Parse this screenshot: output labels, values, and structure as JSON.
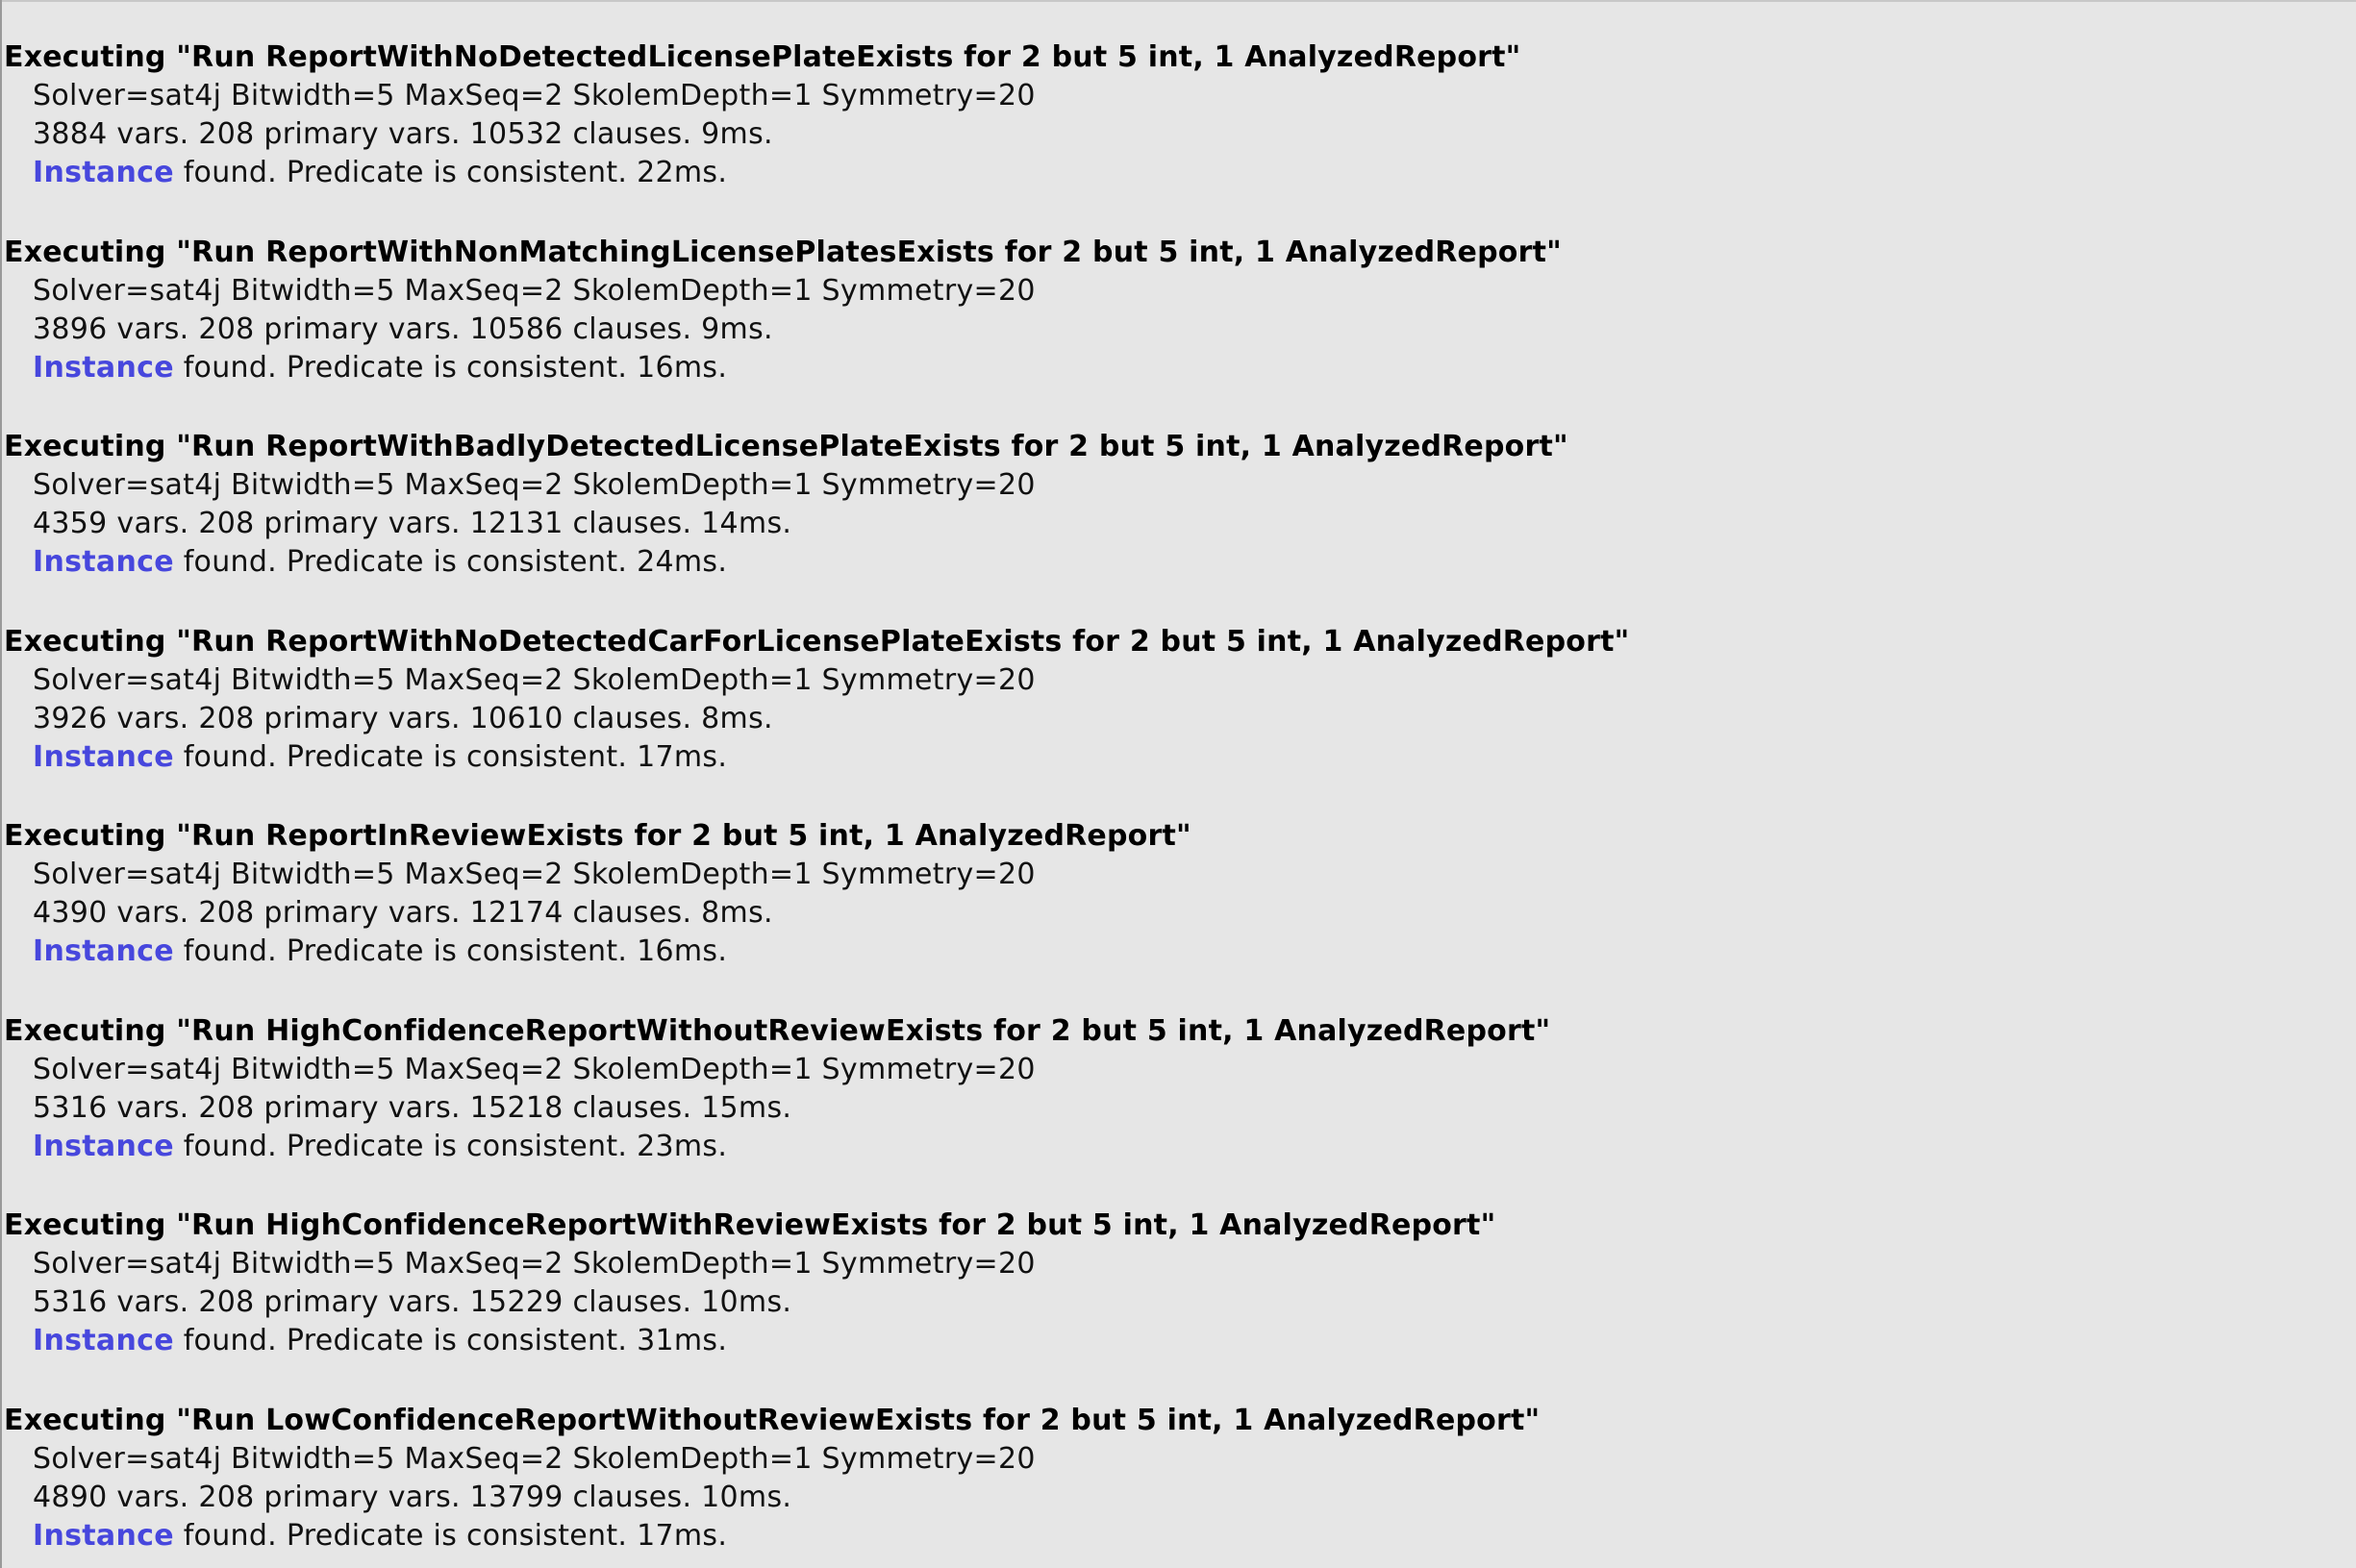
{
  "colors": {
    "background": "#e6e6e6",
    "link": "#4747dd",
    "text": "#000000"
  },
  "log": {
    "entries": [
      {
        "header": "Executing \"Run ReportWithNoDetectedLicensePlateExists for 2 but 5 int, 1 AnalyzedReport\"",
        "solver": "Solver=sat4j Bitwidth=5 MaxSeq=2 SkolemDepth=1 Symmetry=20",
        "stats": "3884 vars. 208 primary vars. 10532 clauses. 9ms.",
        "instance_link": "Instance",
        "result": " found. Predicate is consistent. 22ms."
      },
      {
        "header": "Executing \"Run ReportWithNonMatchingLicensePlatesExists for 2 but 5 int, 1 AnalyzedReport\"",
        "solver": "Solver=sat4j Bitwidth=5 MaxSeq=2 SkolemDepth=1 Symmetry=20",
        "stats": "3896 vars. 208 primary vars. 10586 clauses. 9ms.",
        "instance_link": "Instance",
        "result": " found. Predicate is consistent. 16ms."
      },
      {
        "header": "Executing \"Run ReportWithBadlyDetectedLicensePlateExists for 2 but 5 int, 1 AnalyzedReport\"",
        "solver": "Solver=sat4j Bitwidth=5 MaxSeq=2 SkolemDepth=1 Symmetry=20",
        "stats": "4359 vars. 208 primary vars. 12131 clauses. 14ms.",
        "instance_link": "Instance",
        "result": " found. Predicate is consistent. 24ms."
      },
      {
        "header": "Executing \"Run ReportWithNoDetectedCarForLicensePlateExists for 2 but 5 int, 1 AnalyzedReport\"",
        "solver": "Solver=sat4j Bitwidth=5 MaxSeq=2 SkolemDepth=1 Symmetry=20",
        "stats": "3926 vars. 208 primary vars. 10610 clauses. 8ms.",
        "instance_link": "Instance",
        "result": " found. Predicate is consistent. 17ms."
      },
      {
        "header": "Executing \"Run ReportInReviewExists for 2 but 5 int, 1 AnalyzedReport\"",
        "solver": "Solver=sat4j Bitwidth=5 MaxSeq=2 SkolemDepth=1 Symmetry=20",
        "stats": "4390 vars. 208 primary vars. 12174 clauses. 8ms.",
        "instance_link": "Instance",
        "result": " found. Predicate is consistent. 16ms."
      },
      {
        "header": "Executing \"Run HighConfidenceReportWithoutReviewExists for 2 but 5 int, 1 AnalyzedReport\"",
        "solver": "Solver=sat4j Bitwidth=5 MaxSeq=2 SkolemDepth=1 Symmetry=20",
        "stats": "5316 vars. 208 primary vars. 15218 clauses. 15ms.",
        "instance_link": "Instance",
        "result": " found. Predicate is consistent. 23ms."
      },
      {
        "header": "Executing \"Run HighConfidenceReportWithReviewExists for 2 but 5 int, 1 AnalyzedReport\"",
        "solver": "Solver=sat4j Bitwidth=5 MaxSeq=2 SkolemDepth=1 Symmetry=20",
        "stats": "5316 vars. 208 primary vars. 15229 clauses. 10ms.",
        "instance_link": "Instance",
        "result": " found. Predicate is consistent. 31ms."
      },
      {
        "header": "Executing \"Run LowConfidenceReportWithoutReviewExists for 2 but 5 int, 1 AnalyzedReport\"",
        "solver": "Solver=sat4j Bitwidth=5 MaxSeq=2 SkolemDepth=1 Symmetry=20",
        "stats": "4890 vars. 208 primary vars. 13799 clauses. 10ms.",
        "instance_link": "Instance",
        "result": " found. Predicate is consistent. 17ms."
      }
    ]
  }
}
